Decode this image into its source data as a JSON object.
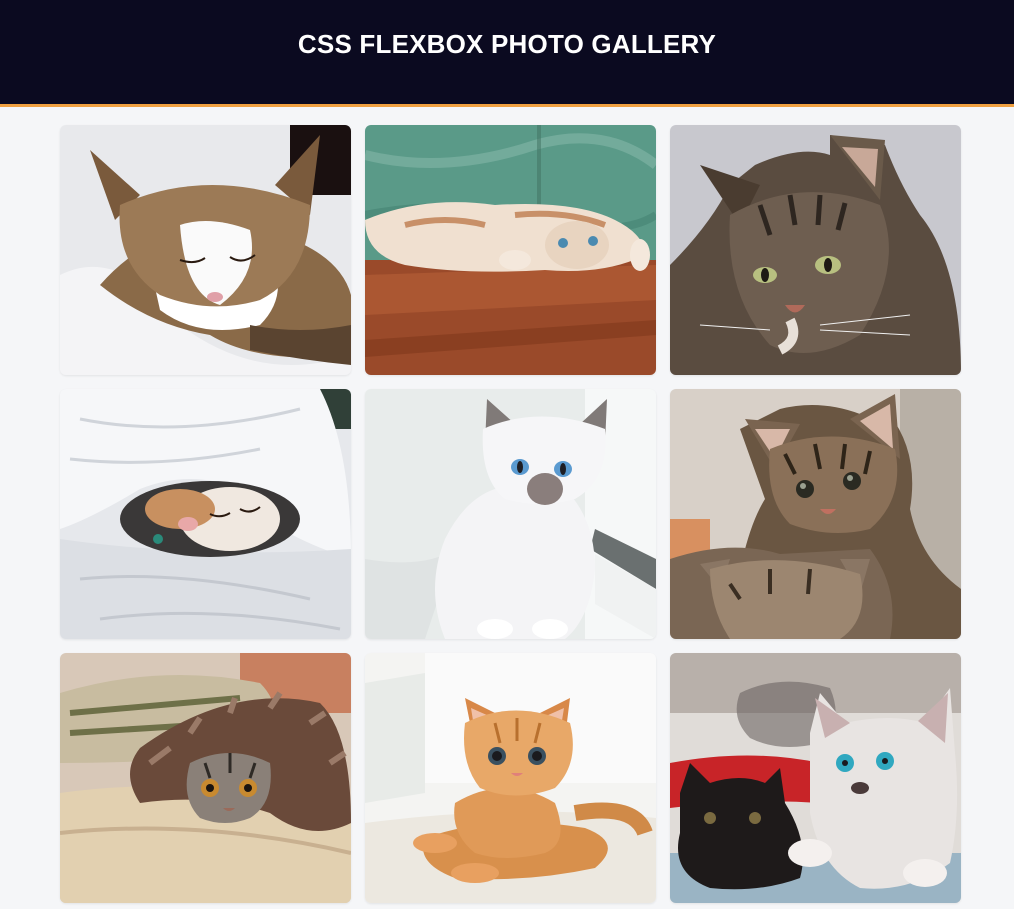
{
  "header": {
    "title": "CSS FLEXBOX PHOTO GALLERY"
  },
  "gallery": {
    "photos": [
      {
        "subject": "sleeping tabby-and-white cat on white blanket"
      },
      {
        "subject": "cat lying upside down on wooden floor against teal wall"
      },
      {
        "subject": "grey tabby long-haired cat portrait"
      },
      {
        "subject": "calico kitten sleeping under white duvet"
      },
      {
        "subject": "white siamese kitten with blue eyes by window"
      },
      {
        "subject": "two tabby kittens"
      },
      {
        "subject": "grey tabby kitten peeking from under brown fluffy blanket"
      },
      {
        "subject": "orange ginger kitten lying on white surface"
      },
      {
        "subject": "white kitten and black kitten on red blanket"
      }
    ]
  },
  "colors": {
    "header_bg": "#0b0a20",
    "header_border": "#f0a040",
    "page_bg": "#f5f6f8"
  }
}
